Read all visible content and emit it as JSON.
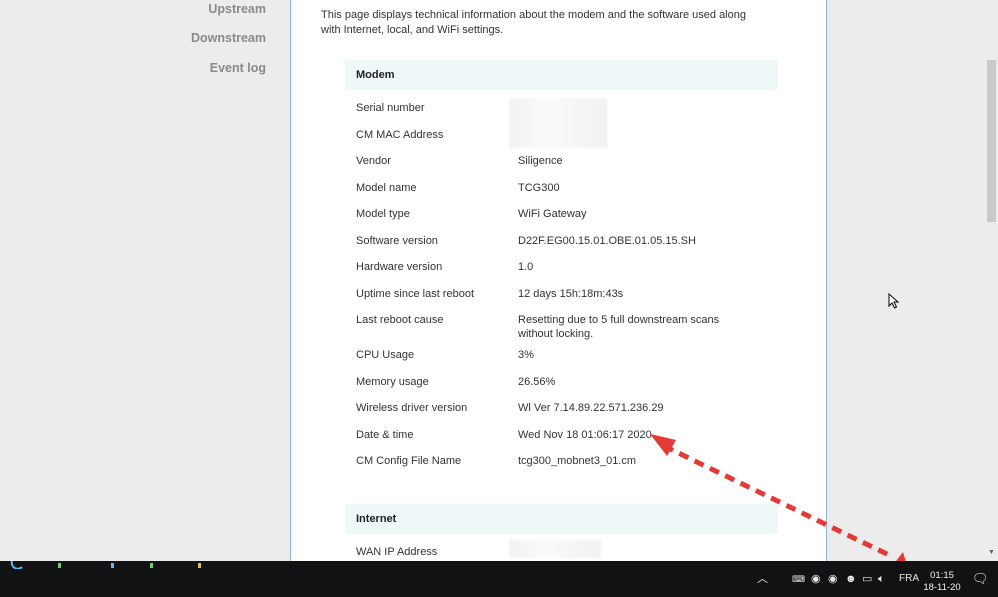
{
  "sidenav": {
    "items": [
      "Upstream",
      "Downstream",
      "Event log"
    ]
  },
  "main": {
    "intro": "This page displays technical information about the modem and the software used along with Internet, local, and WiFi settings.",
    "modem": {
      "title": "Modem",
      "rows": [
        {
          "label": "Serial number",
          "value": ""
        },
        {
          "label": "CM MAC Address",
          "value": ""
        },
        {
          "label": "Vendor",
          "value": "Siligence"
        },
        {
          "label": "Model name",
          "value": "TCG300"
        },
        {
          "label": "Model type",
          "value": "WiFi Gateway"
        },
        {
          "label": "Software version",
          "value": "D22F.EG00.15.01.OBE.01.05.15.SH"
        },
        {
          "label": "Hardware version",
          "value": "1.0"
        },
        {
          "label": "Uptime since last reboot",
          "value": "12 days 15h:18m:43s"
        },
        {
          "label": "Last reboot cause",
          "value": "Resetting due to 5 full downstream scans without locking."
        },
        {
          "label": "CPU Usage",
          "value": "3%"
        },
        {
          "label": "Memory usage",
          "value": "26.56%"
        },
        {
          "label": "Wireless driver version",
          "value": "Wl Ver 7.14.89.22.571.236.29"
        },
        {
          "label": "Date & time",
          "value": "Wed Nov 18 01:06:17 2020"
        },
        {
          "label": "CM Config File Name",
          "value": "tcg300_mobnet3_01.cm"
        }
      ]
    },
    "internet": {
      "title": "Internet",
      "rows": [
        {
          "label": "WAN IP Address",
          "value": ""
        }
      ]
    }
  },
  "taskbar": {
    "language": "FRA",
    "time": "01:15",
    "date": "18-11-20",
    "icons": [
      "chevron-up-icon",
      "keyboard-icon",
      "steam-icon",
      "steam-icon",
      "discord-icon",
      "network-icon",
      "volume-icon",
      "notification-icon"
    ]
  },
  "colors": {
    "section_bg": "#eef8f9",
    "panel_border": "#8fb7d3",
    "arrow": "#e53935"
  }
}
